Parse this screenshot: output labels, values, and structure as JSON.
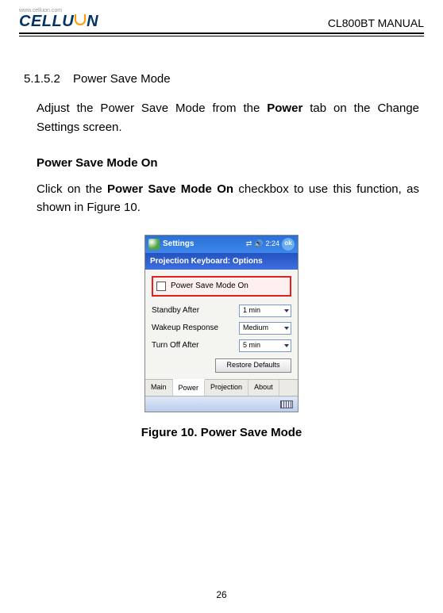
{
  "header": {
    "logo_url": "www.celluon.com",
    "logo_main_left": "CELLU",
    "logo_main_right": "N",
    "doc_title": "CL800BT MANUAL"
  },
  "section": {
    "number": "5.1.5.2",
    "title": "Power Save Mode"
  },
  "para1_pre": "Adjust the Power Save Mode from the ",
  "para1_bold": "Power",
  "para1_post": " tab on the Change Settings screen.",
  "subhead": "Power Save Mode On",
  "para2_pre": "Click on the ",
  "para2_bold": "Power Save Mode On",
  "para2_post": " checkbox to use this function, as shown in Figure 10.",
  "figure": {
    "caption": "Figure 10. Power Save Mode",
    "topbar_title": "Settings",
    "clock": "2:24",
    "ok_label": "ok",
    "window_title": "Projection Keyboard: Options",
    "checkbox_label": "Power Save Mode On",
    "rows": [
      {
        "label": "Standby After",
        "value": "1 min"
      },
      {
        "label": "Wakeup Response",
        "value": "Medium"
      },
      {
        "label": "Turn Off After",
        "value": "5 min"
      }
    ],
    "restore_label": "Restore Defaults",
    "tabs": [
      "Main",
      "Power",
      "Projection",
      "About"
    ],
    "active_tab_index": 1
  },
  "page_number": "26"
}
